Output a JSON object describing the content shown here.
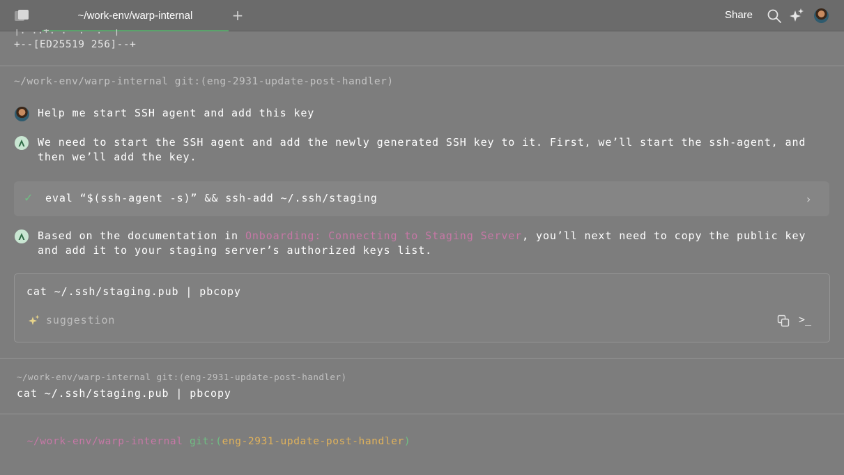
{
  "window": {
    "tab_title": "~/work-env/warp-internal",
    "new_tab_label": "+",
    "share_label": "Share"
  },
  "icons": {
    "sidebar": "sidebar-toggle-icon",
    "search": "search-icon",
    "ai": "sparkle-icon",
    "avatar": "user-avatar"
  },
  "scrollback": {
    "partial_line": "|. ..+. .  .  .  |",
    "key_art_footer": "+--[ED25519 256]--+"
  },
  "block1": {
    "prompt": "~/work-env/warp-internal git:(eng-2931-update-post-handler)",
    "user_message": "Help me start SSH agent and add this key",
    "agent_message_1": "We need to start the SSH agent and add the newly generated SSH key to it. First, we’ll start the ssh-agent, and then we’ll add the key.",
    "executed_command": "eval “$(ssh-agent -s)” && ssh-add ~/.ssh/staging",
    "agent_message_2_prefix": "Based on the documentation in ",
    "agent_message_2_link": "Onboarding: Connecting to Staging Server",
    "agent_message_2_suffix": ", you’ll next need to copy the public key and add it to your staging server’s authorized keys list.",
    "suggested_command": "cat ~/.ssh/staging.pub | pbcopy",
    "suggestion_label": "suggestion",
    "run_label": ">_"
  },
  "block2": {
    "prompt": "~/work-env/warp-internal git:(eng-2931-update-post-handler)",
    "command": "cat ~/.ssh/staging.pub | pbcopy"
  },
  "input_prompt": {
    "path": "~/work-env/warp-internal",
    "git_prefix": "git:(",
    "branch": "eng-2931-update-post-handler",
    "git_suffix": ")"
  },
  "colors": {
    "background": "#7d7d7d",
    "accent_green": "#6fbf83",
    "link_pink": "#c678a6",
    "branch_yellow": "#e0b25b"
  }
}
